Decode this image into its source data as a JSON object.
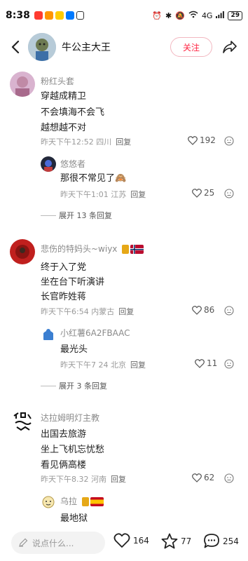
{
  "status": {
    "time": "8:38",
    "signal_text": "4G",
    "battery": "29"
  },
  "header": {
    "user_name": "牛公主大王",
    "follow_label": "关注"
  },
  "comments": [
    {
      "name": "粉红头套",
      "lines": [
        "穿越成精卫",
        "不会填海不会飞",
        "越想越不对"
      ],
      "meta": "昨天下午12:52 四川",
      "reply_label": "回复",
      "likes": "192",
      "replies": [
        {
          "name": "悠悠者",
          "lines": [
            "那很不常见了🙈"
          ],
          "meta": "昨天下午1:01 江苏",
          "reply_label": "回复",
          "likes": "25"
        }
      ],
      "expand_label": "展开 13 条回复"
    },
    {
      "name": "悲伤的特妈头~wiyx",
      "lines": [
        "终于入了党",
        "坐在台下听演讲",
        "长官昨姓蒋"
      ],
      "meta": "昨天下午6:54 内蒙古",
      "reply_label": "回复",
      "likes": "86",
      "replies": [
        {
          "name": "小红薯6A2FBAAC",
          "lines": [
            "最光头"
          ],
          "meta": "昨天下午7 24 北京",
          "reply_label": "回复",
          "likes": "11"
        }
      ],
      "expand_label": "展开 3 条回复"
    },
    {
      "name": "达拉姆明灯主教",
      "lines": [
        "出国去旅游",
        "坐上飞机忘忧愁",
        "看见俩高楼"
      ],
      "meta": "昨天下午8.32 河南",
      "reply_label": "回复",
      "likes": "62",
      "replies": [
        {
          "name": "乌拉",
          "lines": [
            "最地狱"
          ]
        }
      ]
    }
  ],
  "bottom": {
    "input_placeholder": "说点什么...",
    "likes": "164",
    "stars": "77",
    "comments": "254"
  },
  "colors": {
    "accent": "#ff2442",
    "muted": "#8a8a8a"
  }
}
